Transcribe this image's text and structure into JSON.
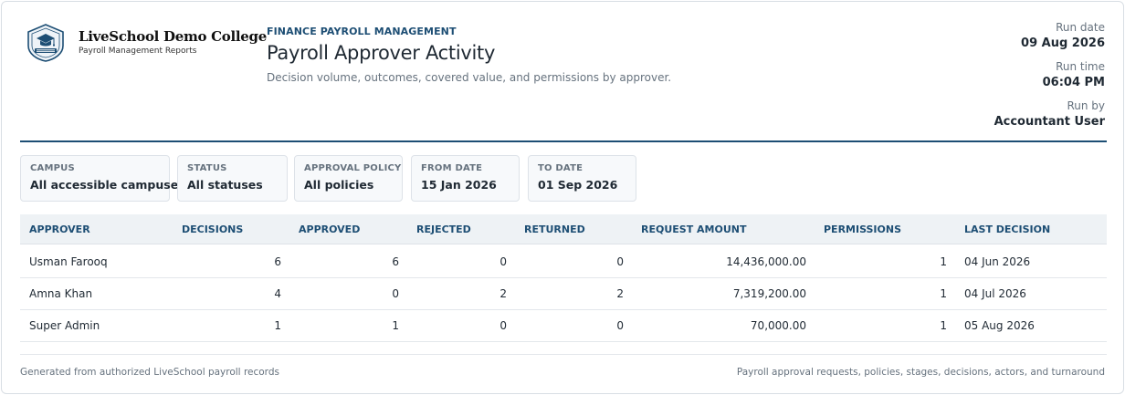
{
  "org": {
    "name": "LiveSchool Demo College",
    "subtitle": "Payroll Management Reports",
    "logo_icon": "graduation-crest-icon"
  },
  "report": {
    "eyebrow": "FINANCE PAYROLL MANAGEMENT",
    "title": "Payroll Approver Activity",
    "subtitle": "Decision volume, outcomes, covered value, and permissions by approver."
  },
  "meta": {
    "run_date_label": "Run date",
    "run_date": "09 Aug 2026",
    "run_time_label": "Run time",
    "run_time": "06:04 PM",
    "run_by_label": "Run by",
    "run_by": "Accountant User"
  },
  "filters": [
    {
      "label": "CAMPUS",
      "value": "All accessible campuses"
    },
    {
      "label": "STATUS",
      "value": "All statuses"
    },
    {
      "label": "APPROVAL POLICY",
      "value": "All policies"
    },
    {
      "label": "FROM DATE",
      "value": "15 Jan 2026"
    },
    {
      "label": "TO DATE",
      "value": "01 Sep 2026"
    }
  ],
  "table": {
    "columns": [
      "APPROVER",
      "DECISIONS",
      "APPROVED",
      "REJECTED",
      "RETURNED",
      "REQUEST AMOUNT",
      "PERMISSIONS",
      "LAST DECISION"
    ],
    "rows": [
      [
        "Usman Farooq",
        "6",
        "6",
        "0",
        "0",
        "14,436,000.00",
        "1",
        "04 Jun 2026"
      ],
      [
        "Amna Khan",
        "4",
        "0",
        "2",
        "2",
        "7,319,200.00",
        "1",
        "04 Jul 2026"
      ],
      [
        "Super Admin",
        "1",
        "1",
        "0",
        "0",
        "70,000.00",
        "1",
        "05 Aug 2026"
      ]
    ]
  },
  "footer": {
    "left": "Generated from authorized LiveSchool payroll records",
    "right": "Payroll approval requests, policies, stages, decisions, actors, and turnaround"
  },
  "colors": {
    "accent": "#1d4e74",
    "muted": "#66727e",
    "header_bg": "#eef2f5"
  }
}
